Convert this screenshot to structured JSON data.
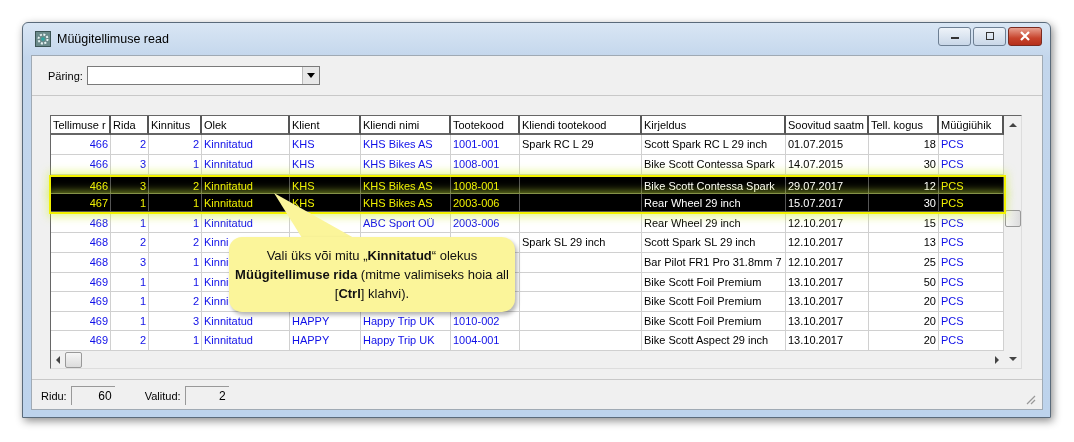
{
  "window": {
    "title": "Müügitellimuse read"
  },
  "query": {
    "label": "Päring:"
  },
  "table": {
    "columns": [
      {
        "label": "Tellimuse r",
        "kind": "link"
      },
      {
        "label": "Rida",
        "kind": "link"
      },
      {
        "label": "Kinnitus",
        "kind": "link"
      },
      {
        "label": "Olek",
        "kind": "link"
      },
      {
        "label": "Klient",
        "kind": "link"
      },
      {
        "label": "Kliendi nimi",
        "kind": "link"
      },
      {
        "label": "Tootekood",
        "kind": "link"
      },
      {
        "label": "Kliendi tootekood",
        "kind": "plain"
      },
      {
        "label": "Kirjeldus",
        "kind": "plain"
      },
      {
        "label": "Soovitud saatm",
        "kind": "plain"
      },
      {
        "label": "Tell. kogus",
        "kind": "plain"
      },
      {
        "label": "Müügiühik",
        "kind": "link"
      }
    ],
    "rows": [
      {
        "selected": false,
        "cells": [
          "466",
          "2",
          "2",
          "Kinnitatud",
          "KHS",
          "KHS Bikes AS",
          "1001-001",
          "Spark RC L 29",
          "Scott Spark RC L 29 inch",
          "01.07.2015",
          "18",
          "PCS"
        ]
      },
      {
        "selected": false,
        "cells": [
          "466",
          "3",
          "1",
          "Kinnitatud",
          "KHS",
          "KHS Bikes AS",
          "1008-001",
          null,
          "Bike Scott Contessa Spark",
          "14.07.2015",
          "30",
          "PCS"
        ]
      },
      {
        "selected": true,
        "cells": [
          "466",
          "3",
          "2",
          "Kinnitatud",
          "KHS",
          "KHS Bikes AS",
          "1008-001",
          null,
          "Bike Scott Contessa Spark",
          "29.07.2017",
          "12",
          "PCS"
        ]
      },
      {
        "selected": true,
        "cells": [
          "467",
          "1",
          "1",
          "Kinnitatud",
          "KHS",
          "KHS Bikes AS",
          "2003-006",
          null,
          "Rear Wheel 29 inch",
          "15.07.2017",
          "30",
          "PCS"
        ]
      },
      {
        "selected": false,
        "cells": [
          "468",
          "1",
          "1",
          "Kinnitatud",
          null,
          "ABC Sport OÜ",
          "2003-006",
          null,
          "Rear Wheel 29 inch",
          "12.10.2017",
          "15",
          "PCS"
        ]
      },
      {
        "selected": false,
        "cells": [
          "468",
          "2",
          "2",
          "Kinni",
          null,
          null,
          null,
          "Spark SL 29 inch",
          "Scott Spark SL 29 inch",
          "12.10.2017",
          "13",
          "PCS"
        ]
      },
      {
        "selected": false,
        "cells": [
          "468",
          "3",
          "1",
          "Kinni",
          null,
          null,
          null,
          null,
          "Bar Pilot FR1 Pro 31.8mm 7",
          "12.10.2017",
          "25",
          "PCS"
        ]
      },
      {
        "selected": false,
        "cells": [
          "469",
          "1",
          "1",
          "Kinni",
          null,
          null,
          null,
          null,
          "Bike Scott Foil Premium",
          "13.10.2017",
          "50",
          "PCS"
        ]
      },
      {
        "selected": false,
        "cells": [
          "469",
          "1",
          "2",
          "Kinni",
          null,
          null,
          null,
          null,
          "Bike Scott Foil Premium",
          "13.10.2017",
          "20",
          "PCS"
        ]
      },
      {
        "selected": false,
        "cells": [
          "469",
          "1",
          "3",
          "Kinnitatud",
          "HAPPY",
          "Happy Trip UK",
          "1010-002",
          null,
          "Bike Scott Foil Premium",
          "13.10.2017",
          "20",
          "PCS"
        ]
      },
      {
        "selected": false,
        "cells": [
          "469",
          "2",
          "1",
          "Kinnitatud",
          "HAPPY",
          "Happy Trip UK",
          "1004-001",
          null,
          "Bike Scott Aspect 29 inch",
          "13.10.2017",
          "20",
          "PCS"
        ]
      }
    ]
  },
  "callout": {
    "text": "Vali üks või mitu „**Kinnitatud**“ olekus **Müügitellimuse rida** (mitme valimiseks hoia all [**Ctrl**] klahvi)."
  },
  "status_bar": {
    "rows_label": "Ridu:",
    "rows_count": "60",
    "selected_label": "Valitud:",
    "selected_count": "2"
  }
}
